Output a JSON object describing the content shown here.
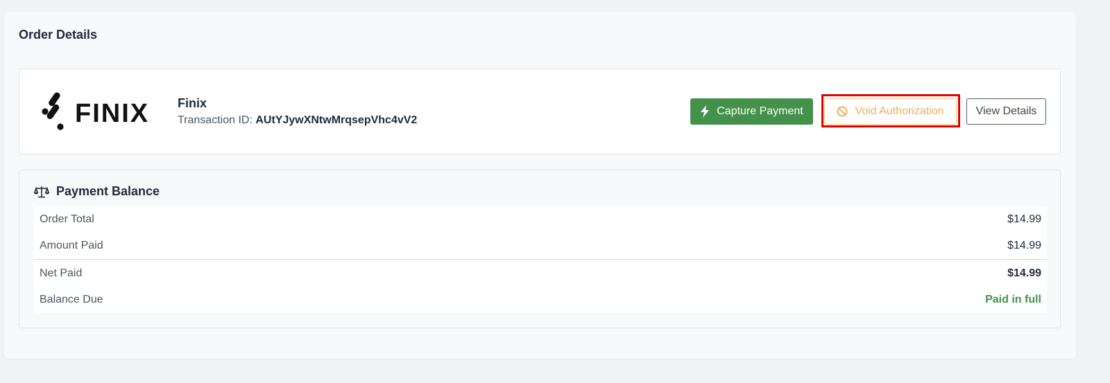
{
  "page": {
    "title": "Order Details"
  },
  "gateway": {
    "logo_text": "FINIX",
    "name": "Finix",
    "transaction_label": "Transaction ID:",
    "transaction_id": "AUtYJywXNtwMrqsepVhc4vV2"
  },
  "actions": {
    "capture_label": "Capture Payment",
    "void_label": "Void Authorization",
    "view_label": "View Details"
  },
  "balance": {
    "title": "Payment Balance",
    "rows": [
      {
        "label": "Order Total",
        "value": "$14.99"
      },
      {
        "label": "Amount Paid",
        "value": "$14.99"
      },
      {
        "label": "Net Paid",
        "value": "$14.99"
      },
      {
        "label": "Balance Due",
        "value": "Paid in full"
      }
    ]
  },
  "icons": {
    "capture": "lightning-bolt-icon",
    "void": "ban-icon",
    "balance": "scale-icon"
  },
  "colors": {
    "success": "#43914a",
    "warning": "#e8b25b",
    "highlight": "#e00000"
  }
}
